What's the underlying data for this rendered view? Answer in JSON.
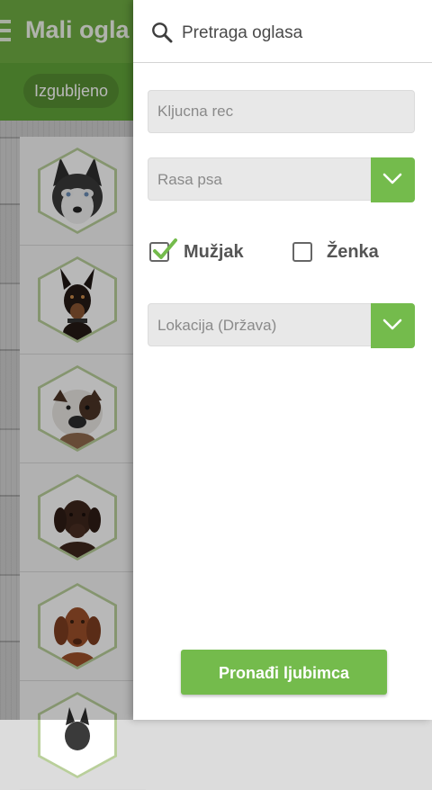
{
  "app": {
    "title": "Mali ogla",
    "tab_label": "Izgubljeno",
    "accent_color": "#6fae43",
    "listings": [
      {
        "icon": "husky-dog-photo"
      },
      {
        "icon": "doberman-dog-photo"
      },
      {
        "icon": "bulldog-photo"
      },
      {
        "icon": "labrador-dog-photo"
      },
      {
        "icon": "vizsla-dog-photo"
      },
      {
        "icon": "dog-photo"
      }
    ]
  },
  "drawer": {
    "title": "Pretraga oglasa",
    "keyword": {
      "placeholder": "Kljucna rec",
      "value": ""
    },
    "breed_select": {
      "selected": "Rasa psa"
    },
    "gender": {
      "male": {
        "label": "Mužjak",
        "checked": true
      },
      "female": {
        "label": "Ženka",
        "checked": false
      }
    },
    "location_select": {
      "selected": "Lokacija (Država)"
    },
    "submit_label": "Pronađi ljubimca",
    "button_color": "#74bb4c"
  }
}
